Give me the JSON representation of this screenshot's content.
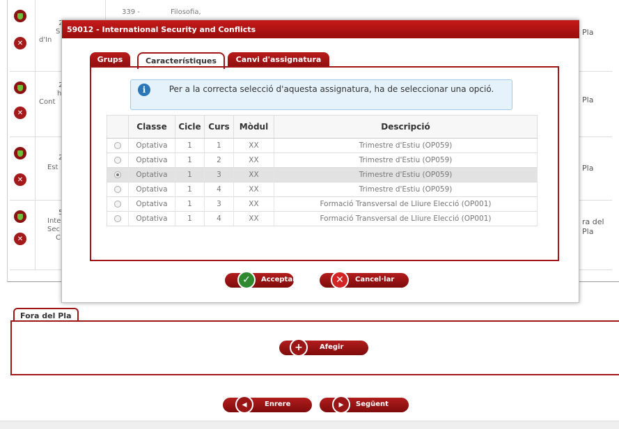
{
  "background": {
    "top_fragments": [
      "339 -",
      "Filosofia,"
    ],
    "rows": [
      {
        "frag_lines": [
          "2",
          "S",
          "d'In"
        ],
        "right_text": "Pla"
      },
      {
        "frag_lines": [
          "2",
          "h",
          "Cont"
        ],
        "right_text": "Pla"
      },
      {
        "frag_lines": [
          "2",
          "Est"
        ],
        "right_text": "Pla"
      },
      {
        "frag_lines": [
          "5",
          "Inte",
          "Sec",
          "C"
        ],
        "right_text": "ra del Pla"
      }
    ]
  },
  "modal": {
    "title": "59012 - International Security and Conflicts",
    "tabs": [
      "Grups",
      "Característiques",
      "Canvi d'assignatura"
    ],
    "active_tab": "Característiques",
    "info": "Per a la correcta selecció d'aquesta assignatura, ha de seleccionar una opció.",
    "table": {
      "headers": [
        "",
        "Classe",
        "Cicle",
        "Curs",
        "Mòdul",
        "Descripció"
      ],
      "rows": [
        [
          "Optativa",
          "1",
          "1",
          "XX",
          "Trimestre d'Estiu (OP059)"
        ],
        [
          "Optativa",
          "1",
          "2",
          "XX",
          "Trimestre d'Estiu (OP059)"
        ],
        [
          "Optativa",
          "1",
          "3",
          "XX",
          "Trimestre d'Estiu (OP059)"
        ],
        [
          "Optativa",
          "1",
          "4",
          "XX",
          "Trimestre d'Estiu (OP059)"
        ],
        [
          "Optativa",
          "1",
          "3",
          "XX",
          "Formació Transversal de Lliure Elecció (OP001)"
        ],
        [
          "Optativa",
          "1",
          "4",
          "XX",
          "Formació Transversal de Lliure Elecció (OP001)"
        ]
      ],
      "selected_row": 2
    },
    "buttons": {
      "accept": "Acceptar",
      "cancel": "Cancel·lar"
    }
  },
  "fora": {
    "tab_label": "Fora del Pla",
    "add_label": "Afegir"
  },
  "nav": {
    "back": "Enrere",
    "next": "Següent"
  },
  "colors": {
    "brand": "#a01616",
    "accept_icon": "#2f8a2f",
    "cancel_icon": "#d22424"
  }
}
